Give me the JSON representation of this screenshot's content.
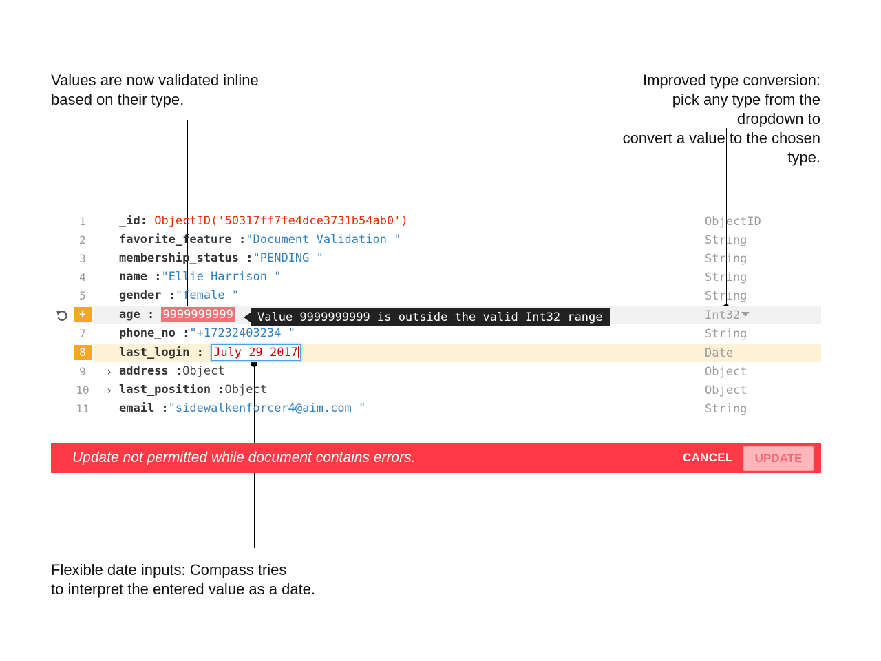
{
  "annotations": {
    "validated": "Values are now validated inline\nbased on their type.",
    "conversion": "Improved type conversion:\npick any type from the\ndropdown to\nconvert a value to the chosen\ntype.",
    "dates": "Flexible date inputs: Compass tries\nto interpret the entered value as a date."
  },
  "rows": [
    {
      "line": "1",
      "key": "_id",
      "sep": ":",
      "value": "ObjectID('50317ff7fe4dce3731b54ab0')",
      "type": "ObjectID"
    },
    {
      "line": "2",
      "key": "favorite_feature ",
      "sep": ":",
      "value": "Document Validation ",
      "type": "String"
    },
    {
      "line": "3",
      "key": "membership_status ",
      "sep": ":",
      "value": "PENDING ",
      "type": "String"
    },
    {
      "line": "4",
      "key": "name ",
      "sep": ":",
      "value": "Ellie Harrison ",
      "type": "String"
    },
    {
      "line": "5",
      "key": "gender ",
      "sep": ":",
      "value": "female ",
      "type": "String"
    },
    {
      "line": "+",
      "key": "age ",
      "sep": ":",
      "value": "9999999999",
      "type": "Int32"
    },
    {
      "line": "7",
      "key": "phone_no ",
      "sep": ":",
      "value": "+17232403234 ",
      "type": "String"
    },
    {
      "line": "8",
      "key": "last_login ",
      "sep": ":",
      "value": "July 29 2017",
      "type": "Date"
    },
    {
      "line": "9",
      "key": "address ",
      "sep": ":",
      "value": "Object",
      "type": "Object"
    },
    {
      "line": "10",
      "key": "last_position ",
      "sep": ":",
      "value": "Object",
      "type": "Object"
    },
    {
      "line": "11",
      "key": "email ",
      "sep": ":",
      "value": "sidewalkenforcer4@aim.com ",
      "type": "String"
    }
  ],
  "tooltip": "Value 9999999999 is outside the valid Int32 range",
  "quote": "\"",
  "footer": {
    "message": "Update not permitted while document contains errors.",
    "cancel_label": "CANCEL",
    "update_label": "UPDATE"
  },
  "icons": {
    "revert": "revert-icon",
    "expand": "chevron-right-icon",
    "dropdown": "caret-down-icon"
  },
  "colors": {
    "error_banner": "#fd3a46",
    "warning_badge": "#f5a623",
    "objectid": "#ea2c00",
    "string": "#2f7fc1",
    "invalid_value_bg": "#f3727a",
    "focus_border": "#4aa3e6"
  }
}
